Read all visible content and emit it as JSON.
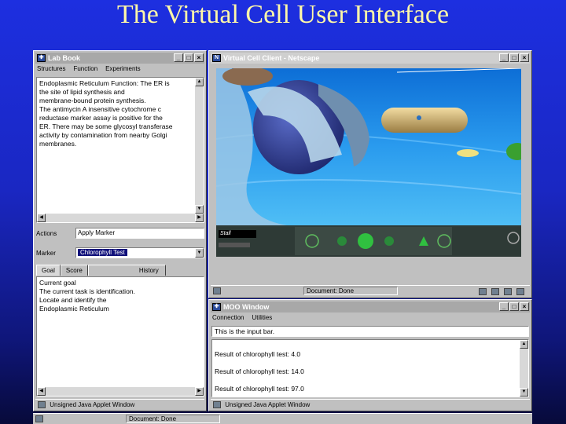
{
  "slide": {
    "title": "The Virtual Cell User Interface"
  },
  "lab_book": {
    "title": "Lab Book",
    "menu": [
      "Structures",
      "Function",
      "Experiments"
    ],
    "description": "Endoplasmic Reticulum Function: The ER is\nthe site of lipid synthesis and\nmembrane-bound protein synthesis.\nThe antimycin A insensitive cytochrome c\nreductase marker assay is positive for the\nER. There may be some glycosyl transferase\nactivity by contamination from nearby Golgi\nmembranes.",
    "actions_label": "Actions",
    "actions_value": "Apply Marker",
    "marker_label": "Marker",
    "marker_value": "Chlorophyll Test",
    "tabs": [
      "Goal",
      "Score",
      "History"
    ],
    "goal_text": "Current goal\nThe current task is identification.\nLocate and identify the\nEndoplasmic Reticulum",
    "status": "Unsigned Java Applet Window"
  },
  "netscape": {
    "title": "Virtual Cell Client - Netscape",
    "field_text": "Stall",
    "status": "Document: Done"
  },
  "moo": {
    "title": "MOO Window",
    "menu": [
      "Connection",
      "Utilities"
    ],
    "input_value": "This is the input bar.",
    "output": [
      "Result of chlorophyll test: 4.0",
      "Result of chlorophyll test: 14.0",
      "Result of chlorophyll test: 97.0"
    ],
    "status": "Unsigned Java Applet Window"
  },
  "taskbar": {
    "status": "Document: Done"
  },
  "colors": {
    "slide_title": "#fff8a8",
    "background": "#1d2fe0",
    "selection": "#10107a"
  }
}
